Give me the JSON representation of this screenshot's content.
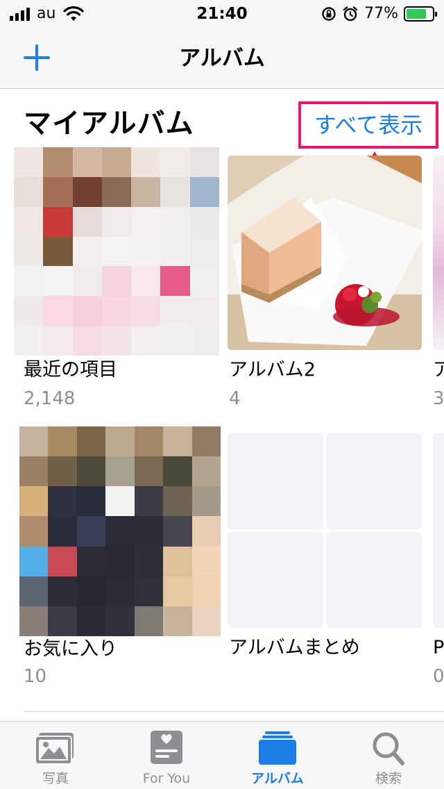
{
  "status_bar": {
    "carrier": "au",
    "time": "21:40",
    "battery": "77%",
    "battery_level": 0.77
  },
  "nav": {
    "title": "アルバム",
    "add_icon": "plus-icon"
  },
  "section": {
    "title": "マイアルバム",
    "see_all": "すべて表示"
  },
  "albums": [
    {
      "name": "最近の項目",
      "count": "2,148"
    },
    {
      "name": "アルバム2",
      "count": "4"
    },
    {
      "name": "ア",
      "count": "3"
    },
    {
      "name": "お気に入り",
      "count": "10"
    },
    {
      "name": "アルバムまとめ",
      "count": ""
    },
    {
      "name": "P",
      "count": "0"
    }
  ],
  "tabs": [
    {
      "label": "写真",
      "icon": "photos-icon"
    },
    {
      "label": "For You",
      "icon": "for-you-icon"
    },
    {
      "label": "アルバム",
      "icon": "albums-icon",
      "active": true
    },
    {
      "label": "検索",
      "icon": "search-icon"
    }
  ],
  "colors": {
    "accent": "#1a7ee6",
    "highlight": "#ef1568",
    "secondary_text": "#8e8e93"
  }
}
